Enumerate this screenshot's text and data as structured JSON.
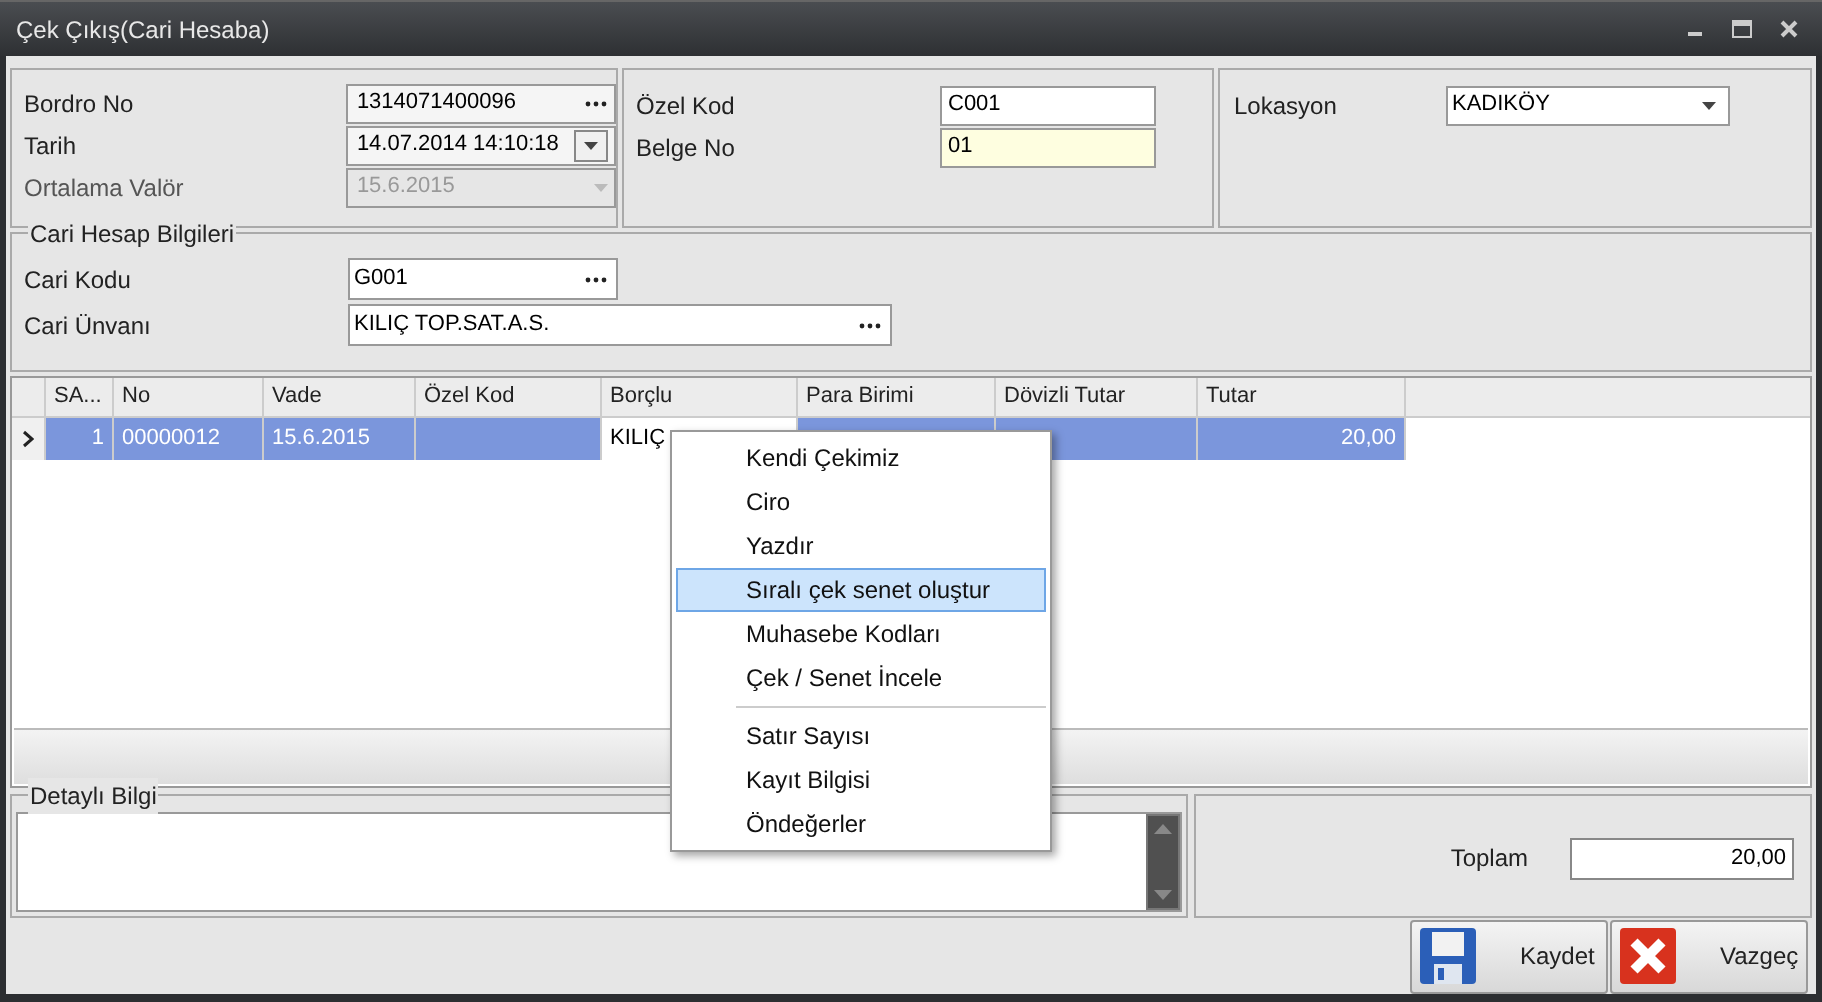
{
  "window": {
    "title": "Çek Çıkış(Cari Hesaba)"
  },
  "header": {
    "left": [
      {
        "label": "Bordro No",
        "value": "1314071400096",
        "kind": "lookup",
        "disabled": false
      },
      {
        "label": "Tarih",
        "value": "14.07.2014 14:10:18",
        "kind": "datetime",
        "disabled": false
      },
      {
        "label": "Ortalama Valör",
        "value": "15.6.2015",
        "kind": "combo",
        "disabled": true
      }
    ],
    "middle": [
      {
        "label": "Özel Kod",
        "value": "C001",
        "highlighted": false
      },
      {
        "label": "Belge No",
        "value": "01",
        "highlighted": true
      }
    ],
    "right": [
      {
        "label": "Lokasyon",
        "value": "KADIKÖY"
      }
    ]
  },
  "account": {
    "title": "Cari Hesap Bilgileri",
    "fields": [
      {
        "label": "Cari Kodu",
        "value": "G001",
        "wide": false
      },
      {
        "label": "Cari Ünvanı",
        "value": "KILIÇ TOP.SAT.A.S.",
        "wide": true
      }
    ]
  },
  "table": {
    "columns": [
      "SA...",
      "No",
      "Vade",
      "Özel Kod",
      "Borçlu",
      "Para Birimi",
      "Dövizli Tutar",
      "Tutar"
    ],
    "rows": [
      {
        "selected": true,
        "cells": [
          "1",
          "00000012",
          "15.6.2015",
          "",
          "KILIÇ",
          "",
          "",
          "20,00"
        ]
      }
    ]
  },
  "context_menu": {
    "groups": [
      [
        {
          "label": "Kendi Çekimiz",
          "selected": false
        },
        {
          "label": "Ciro",
          "selected": false
        },
        {
          "label": "Yazdır",
          "selected": false
        },
        {
          "label": "Sıralı çek senet oluştur",
          "selected": true
        },
        {
          "label": "Muhasebe Kodları",
          "selected": false
        },
        {
          "label": "Çek / Senet İncele",
          "selected": false
        }
      ],
      [
        {
          "label": "Satır Sayısı",
          "selected": false
        },
        {
          "label": "Kayıt Bilgisi",
          "selected": false
        },
        {
          "label": "Öndeğerler",
          "selected": false
        }
      ]
    ]
  },
  "details": {
    "title": "Detaylı Bilgi"
  },
  "total": {
    "label": "Toplam",
    "value": "20,00"
  },
  "buttons": [
    {
      "label": "Kaydet",
      "kind": "save"
    },
    {
      "label": "Vazgeç",
      "kind": "cancel"
    }
  ]
}
